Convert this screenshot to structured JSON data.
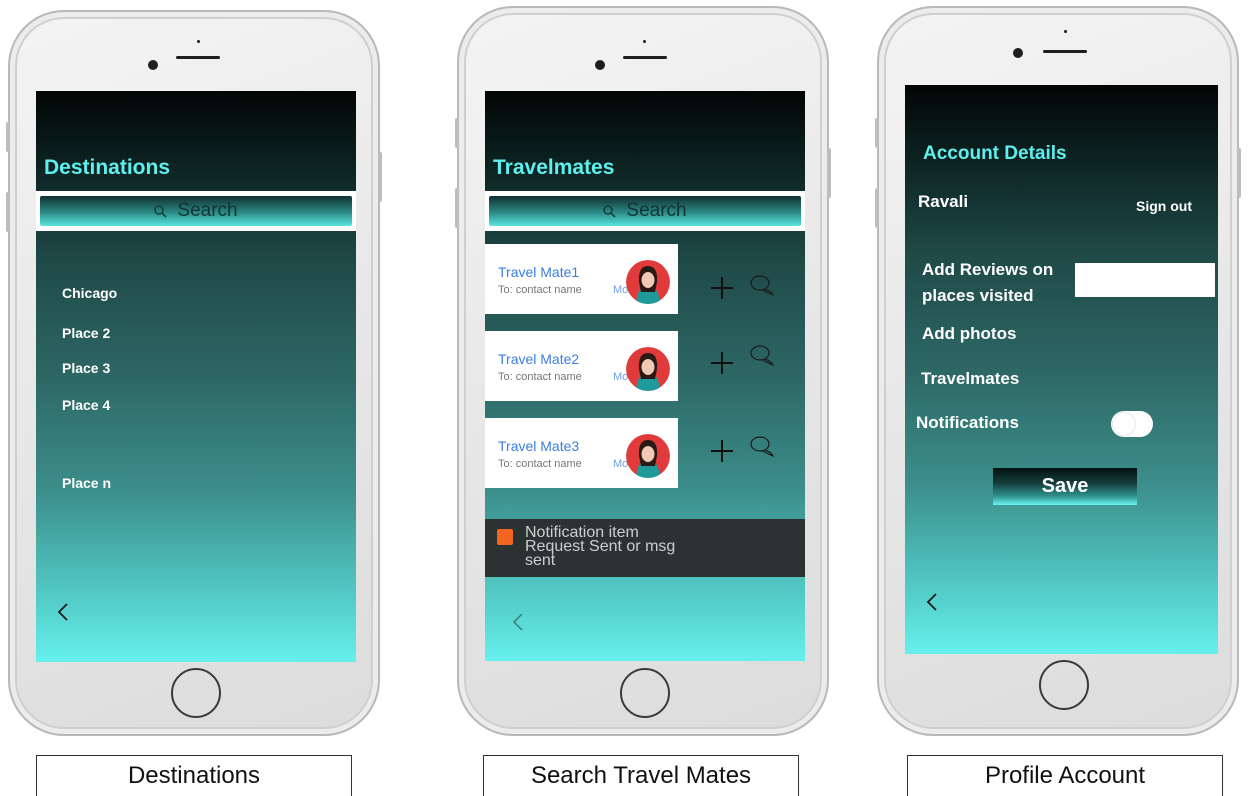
{
  "destinations": {
    "title": "Destinations",
    "search_placeholder": "Search",
    "places": [
      "Chicago",
      "Place 2",
      "Place 3",
      "Place 4",
      "Place n"
    ],
    "back_glyph": "<",
    "caption": "Destinations"
  },
  "travelmates": {
    "title": "Travelmates",
    "search_placeholder": "Search",
    "mates": [
      {
        "name": "Travel Mate1",
        "sub": "To: contact name",
        "more": "Mo"
      },
      {
        "name": "Travel Mate2",
        "sub": "To: contact name",
        "more": "Mo"
      },
      {
        "name": "Travel Mate3",
        "sub": "To: contact name",
        "more": "Mo"
      }
    ],
    "notification": "Notification item Request  Sent  or msg sent",
    "caption": "Search Travel Mates"
  },
  "profile": {
    "title": "Account Details",
    "user_name": "Ravali",
    "sign_out": "Sign out",
    "add_reviews": "Add Reviews on places visited",
    "add_photos": "Add photos",
    "travelmates": "Travelmates",
    "notifications": "Notifications",
    "save": "Save",
    "caption": "Profile Account"
  },
  "colors": {
    "accent_title": "#5ef0ee",
    "link_blue": "#3a7ee0",
    "notification_orange": "#f2641f"
  },
  "icons": [
    "search-icon",
    "chevron-left-icon",
    "plus-icon",
    "chat-bubble-icon",
    "home-button-icon",
    "avatar"
  ]
}
